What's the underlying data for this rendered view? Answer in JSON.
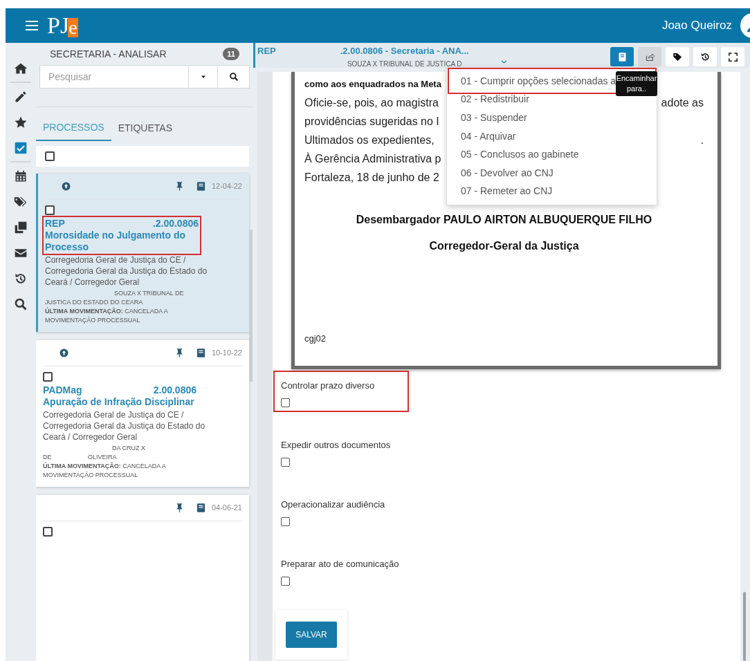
{
  "header": {
    "logo_main": "PJ",
    "logo_accent": "e",
    "user_name": "Joao Queiroz"
  },
  "nav_rail": {
    "items": [
      {
        "kind": "home",
        "selected": false
      },
      {
        "kind": "pencil",
        "selected": false
      },
      {
        "kind": "star",
        "selected": false
      },
      {
        "kind": "check",
        "selected": true
      },
      {
        "kind": "calendar",
        "selected": false
      },
      {
        "kind": "tags",
        "selected": false
      },
      {
        "kind": "copy",
        "selected": false
      },
      {
        "kind": "mail",
        "selected": false
      },
      {
        "kind": "history",
        "selected": false
      },
      {
        "kind": "search",
        "selected": false
      }
    ]
  },
  "task_list": {
    "title": "SECRETARIA - ANALISAR",
    "count": "11",
    "search": {
      "placeholder": "Pesquisar"
    },
    "tabs": [
      {
        "label": "PROCESSOS",
        "selected": true
      },
      {
        "label": "ETIQUETAS",
        "selected": false
      }
    ],
    "select_all": {
      "checked": false
    },
    "cards": [
      {
        "selected": true,
        "up_arrow": true,
        "date": "12-04-22",
        "checked": false,
        "highlighted": true,
        "class": "REP",
        "number": ".2.00.0806",
        "subject": "Morosidade no Julgamento do Processo",
        "organ": "Corregedoria Geral de Justiça do CE / Corregedoria Geral da Justiça do Estado do Ceará / Corregedor Geral",
        "parties": [
          "SOUZA X TRIBUNAL DE JUSTICA DO ESTADO DO CEARA"
        ],
        "last_movement": "**ÚLTIMA MOVIMENTAÇÃO:** CANCELADA A MOVIMENTAÇÃO PROCESSUAL"
      },
      {
        "selected": false,
        "up_arrow": true,
        "date": "10-10-22",
        "checked": false,
        "highlighted": false,
        "class": "PADMag",
        "number": "2.00.0806",
        "subject": "Apuração de Infração Disciplinar",
        "organ": "Corregedoria Geral de Justiça do CE / Corregedoria Geral da Justiça do Estado do Ceará / Corregedor Geral",
        "parties": [
          "DA CRUZ X",
          "DE",
          "OLIVEIRA"
        ],
        "last_movement": "**ÚLTIMA MOVIMENTAÇÃO:** CANCELADA A MOVIMENTAÇÃO PROCESSUAL"
      },
      {
        "selected": false,
        "up_arrow": false,
        "date": "04-06-21",
        "checked": false,
        "highlighted": false
      }
    ]
  },
  "process_tab": {
    "class": "REP",
    "title": ".2.00.0806 - Secretaria - ANA...",
    "subtitle": "SOUZA X TRIBUNAL DE JUSTICA D",
    "toolbar": [
      {
        "kind": "book",
        "selected": true
      },
      {
        "kind": "forward",
        "selected": false,
        "active": true
      },
      {
        "kind": "tag",
        "selected": false,
        "active": false
      },
      {
        "kind": "history",
        "selected": false,
        "active": false
      },
      {
        "kind": "expand",
        "selected": false,
        "active": false
      }
    ]
  },
  "document": {
    "lines": [
      {
        "kind": "bold",
        "left": "como aos enquadrados na Meta"
      },
      {
        "kind": "text",
        "left": "Oficie-se, pois, ao magistra",
        "right": "adote as"
      },
      {
        "kind": "text",
        "left": "providências sugeridas no I"
      },
      {
        "kind": "text",
        "left": "Ultimados os expedientes,",
        "right": "."
      },
      {
        "kind": "text",
        "left": "À Gerência Administrativa p"
      },
      {
        "kind": "text",
        "left": "Fortaleza, 18 de junho de 2"
      }
    ],
    "signature": [
      "Desembargador PAULO AIRTON ALBUQUERQUE FILHO",
      "Corregedor-Geral da Justiça"
    ],
    "footer_code": "cgj02"
  },
  "forward_menu": {
    "items": [
      {
        "label": "01 - Cumprir opções selecionadas a",
        "highlighted": true
      },
      {
        "label": "02 - Redistribuir",
        "highlighted": false
      },
      {
        "label": "03 - Suspender",
        "highlighted": false
      },
      {
        "label": "04 - Arquivar",
        "highlighted": false
      },
      {
        "label": "05 - Conclusos ao gabinete",
        "highlighted": false
      },
      {
        "label": "06 - Devolver ao CNJ",
        "highlighted": false
      },
      {
        "label": "07 - Remeter ao CNJ",
        "highlighted": false
      }
    ],
    "tooltip": "Encaminhar para.."
  },
  "options": [
    {
      "label": "Controlar prazo diverso",
      "checked": false,
      "highlighted": true
    },
    {
      "label": "Expedir outros documentos",
      "checked": false,
      "highlighted": false
    },
    {
      "label": "Operacionalizar audiência",
      "checked": false,
      "highlighted": false
    },
    {
      "label": "Preparar ato de comunicação",
      "checked": false,
      "highlighted": false
    }
  ],
  "save_button": "SALVAR"
}
